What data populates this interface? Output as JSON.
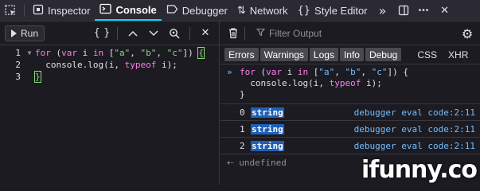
{
  "toolbar": {
    "tabs": [
      {
        "label": "Inspector",
        "icon": "inspector-icon"
      },
      {
        "label": "Console",
        "icon": "console-icon",
        "active": true
      },
      {
        "label": "Debugger",
        "icon": "debugger-icon"
      },
      {
        "label": "Network",
        "icon": "network-icon"
      },
      {
        "label": "Style Editor",
        "icon": "style-editor-icon"
      }
    ],
    "overflow": "»",
    "more": "•••",
    "close": "✕"
  },
  "editor": {
    "run_label": "Run",
    "line_numbers": [
      "1",
      "2",
      "3"
    ]
  },
  "console": {
    "filter_placeholder": "Filter Output",
    "filter_buttons": [
      "Errors",
      "Warnings",
      "Logs",
      "Info",
      "Debug"
    ],
    "plain_filters": [
      "CSS",
      "XHR",
      "R"
    ],
    "messages": [
      {
        "index": "0",
        "value": "string",
        "location": "debugger eval code:2:11"
      },
      {
        "index": "1",
        "value": "string",
        "location": "debugger eval code:2:11"
      },
      {
        "index": "2",
        "value": "string",
        "location": "debugger eval code:2:11"
      }
    ],
    "result": "undefined"
  },
  "watermark": {
    "text": "ifunny.co"
  },
  "colors": {
    "accent": "#00ddff",
    "keyword": "#ff7de9",
    "string": "#86de74",
    "link": "#75bfff",
    "highlight": "#1f5fb5"
  }
}
